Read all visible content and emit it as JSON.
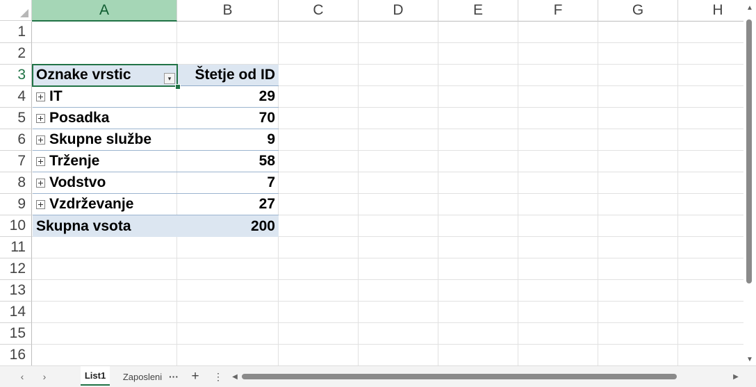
{
  "columns": [
    "A",
    "B",
    "C",
    "D",
    "E",
    "F",
    "G",
    "H"
  ],
  "rows": [
    "1",
    "2",
    "3",
    "4",
    "5",
    "6",
    "7",
    "8",
    "9",
    "10",
    "11",
    "12",
    "13",
    "14",
    "15",
    "16"
  ],
  "pivot": {
    "header_label": "Oznake vrstic",
    "header_value": "Štetje od ID",
    "items": [
      {
        "label": "IT",
        "value": "29"
      },
      {
        "label": "Posadka",
        "value": "70"
      },
      {
        "label": "Skupne službe",
        "value": "9"
      },
      {
        "label": "Trženje",
        "value": "58"
      },
      {
        "label": "Vodstvo",
        "value": "7"
      },
      {
        "label": "Vzdrževanje",
        "value": "27"
      }
    ],
    "total_label": "Skupna vsota",
    "total_value": "200"
  },
  "icons": {
    "filter": "dropdown-filter-icon",
    "expand": "expand-plus-icon"
  },
  "tabbar": {
    "prev": "‹",
    "next": "›",
    "tabs": [
      "List1",
      "Zaposleni"
    ],
    "more": "···",
    "add": "+",
    "menu": "⋮"
  },
  "colors": {
    "accent": "#217346",
    "pivot_header_fill": "#dce6f1",
    "selected_column_header": "#a5d6b6"
  }
}
